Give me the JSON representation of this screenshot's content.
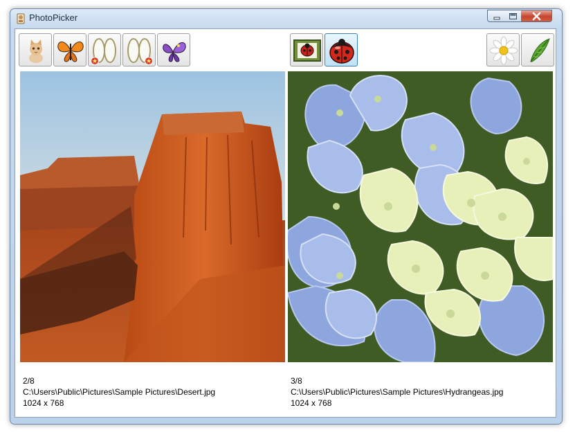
{
  "window": {
    "title": "PhotoPicker",
    "icon": "app-icon"
  },
  "title_controls": [
    "minimize-icon",
    "maximize-icon",
    "close-icon"
  ],
  "toolbar": {
    "left_buttons": [
      {
        "icon": "kitten-icon"
      },
      {
        "icon": "butterfly-icon"
      },
      {
        "icon": "oval-frames-icon",
        "badge": "red-star-badge-icon"
      },
      {
        "icon": "oval-frames-icon",
        "badge": "red-star-badge-icon"
      },
      {
        "icon": "purple-butterfly-icon"
      }
    ],
    "center_buttons": [
      {
        "icon": "framed-ladybug-icon",
        "state": "normal"
      },
      {
        "icon": "ladybug-icon",
        "state": "pressed"
      }
    ],
    "right_buttons": [
      {
        "icon": "daisy-icon"
      },
      {
        "icon": "feather-icon"
      }
    ]
  },
  "left_panel": {
    "image": "desert-photo",
    "index": "2/8",
    "path": "C:\\Users\\Public\\Pictures\\Sample Pictures\\Desert.jpg",
    "size": "1024 x 768"
  },
  "right_panel": {
    "image": "hydrangeas-photo",
    "index": "3/8",
    "path": "C:\\Users\\Public\\Pictures\\Sample Pictures\\Hydrangeas.jpg",
    "size": "1024 x 768"
  }
}
